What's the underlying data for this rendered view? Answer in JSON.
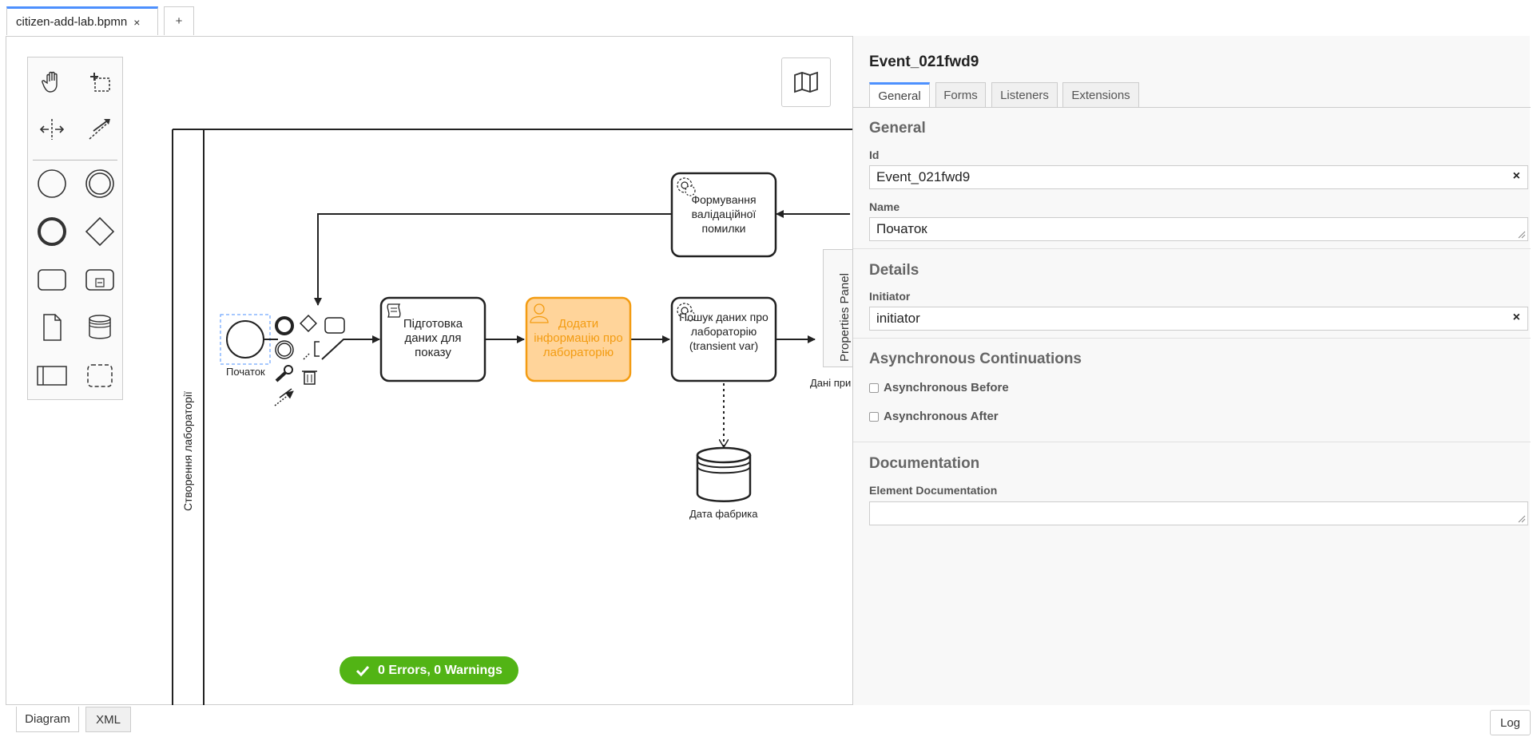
{
  "file_tab": {
    "name": "citizen-add-lab.bpmn",
    "close": "×",
    "add": "+"
  },
  "palette": {
    "tools": [
      {
        "name": "hand-tool-icon"
      },
      {
        "name": "lasso-tool-icon"
      },
      {
        "name": "space-tool-icon"
      },
      {
        "name": "global-connect-tool-icon"
      },
      {
        "name": "start-event-icon"
      },
      {
        "name": "intermediate-event-icon"
      },
      {
        "name": "end-event-icon"
      },
      {
        "name": "gateway-icon"
      },
      {
        "name": "task-icon"
      },
      {
        "name": "subprocess-icon"
      },
      {
        "name": "data-object-icon"
      },
      {
        "name": "data-store-icon"
      },
      {
        "name": "pool-icon"
      },
      {
        "name": "group-icon"
      }
    ]
  },
  "diagram": {
    "lane_label": "Створення лабораторії",
    "start_event_label": "Початок",
    "tasks": {
      "prepare": "Підготовка даних для показу",
      "add_info": "Додати інформацію про лабораторію",
      "search": "Пошук даних про лабораторію (transient var)",
      "validation": "Формування валідаційної помилки"
    },
    "data_store_label": "Дата фабрика",
    "cut_label": "Дані при"
  },
  "status": {
    "text": "0 Errors, 0 Warnings"
  },
  "properties": {
    "toggle_label": "Properties Panel",
    "element_title": "Event_021fwd9",
    "tabs": [
      "General",
      "Forms",
      "Listeners",
      "Extensions"
    ],
    "general": {
      "group_title": "General",
      "id_label": "Id",
      "id_value": "Event_021fwd9",
      "name_label": "Name",
      "name_value": "Початок"
    },
    "details": {
      "group_title": "Details",
      "initiator_label": "Initiator",
      "initiator_value": "initiator"
    },
    "async": {
      "group_title": "Asynchronous Continuations",
      "before": "Asynchronous Before",
      "after": "Asynchronous After"
    },
    "documentation": {
      "group_title": "Documentation",
      "label": "Element Documentation",
      "value": ""
    },
    "clear_icon": "×"
  },
  "bottom": {
    "diagram": "Diagram",
    "xml": "XML",
    "log": "Log"
  },
  "colors": {
    "accent": "#4d90fe",
    "success": "#52b415",
    "user_task_fill": "#ffd49a",
    "user_task_stroke": "#f39c12"
  }
}
